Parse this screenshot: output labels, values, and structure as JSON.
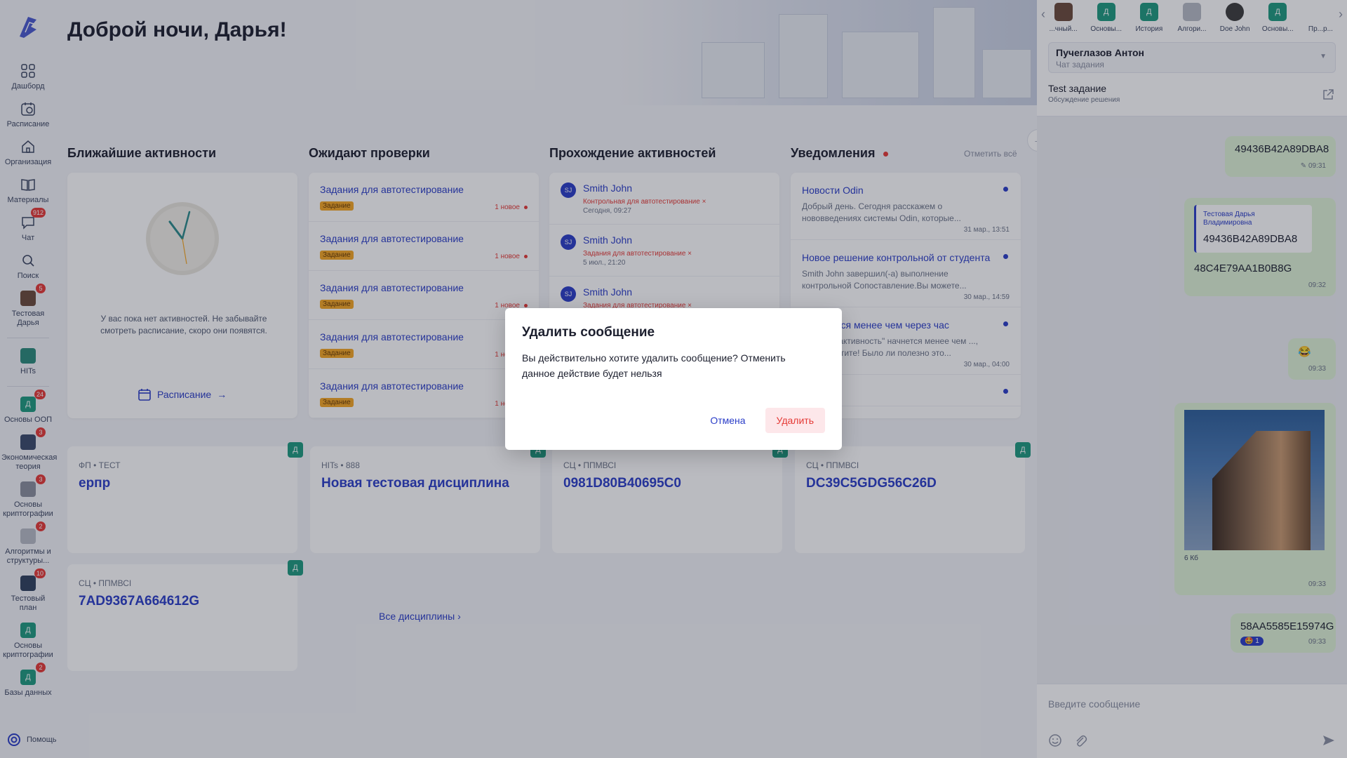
{
  "greeting": "Доброй ночи, Дарья!",
  "sidebar": {
    "items": [
      {
        "label": "Дашборд"
      },
      {
        "label": "Расписание"
      },
      {
        "label": "Организация"
      },
      {
        "label": "Материалы"
      },
      {
        "label": "Чат",
        "badge": "912"
      },
      {
        "label": "Поиск"
      },
      {
        "label": "Тестовая Дарья",
        "badge": "5"
      },
      {
        "label": "HITs"
      },
      {
        "label": "Основы ООП",
        "badge": "24",
        "letter": "Д"
      },
      {
        "label": "Экономическая теория",
        "badge": "3"
      },
      {
        "label": "Основы криптографии",
        "badge": "3"
      },
      {
        "label": "Алгоритмы и структуры...",
        "badge": "2"
      },
      {
        "label": "Тестовый план",
        "badge": "10"
      },
      {
        "label": "Основы криптографии",
        "letter": "Д"
      },
      {
        "label": "Базы данных",
        "badge": "2",
        "letter": "Д"
      }
    ],
    "help": "Помощь"
  },
  "columns": {
    "nearest": {
      "title": "Ближайшие активности",
      "empty": "У вас пока нет активностей. Не забывайте смотреть расписание, скоро они появятся.",
      "link": "Расписание"
    },
    "review": {
      "title": "Ожидают проверки",
      "items": [
        {
          "title": "Задания для автотестирование",
          "tag": "Задание",
          "new": "1 новое"
        },
        {
          "title": "Задания для автотестирование",
          "tag": "Задание",
          "new": "1 новое"
        },
        {
          "title": "Задания для автотестирование",
          "tag": "Задание",
          "new": "1 новое"
        },
        {
          "title": "Задания для автотестирование",
          "tag": "Задание",
          "new": "1 новое"
        },
        {
          "title": "Задания для автотестирование",
          "tag": "Задание",
          "new": "1 новое"
        }
      ]
    },
    "progress": {
      "title": "Прохождение активностей",
      "items": [
        {
          "initials": "SJ",
          "name": "Smith John",
          "sub": "Контрольная для автотестирование ×",
          "date": "Сегодня, 09:27"
        },
        {
          "initials": "SJ",
          "name": "Smith John",
          "sub": "Задания для автотестирование ×",
          "date": "5 июл., 21:20"
        },
        {
          "initials": "SJ",
          "name": "Smith John",
          "sub": "Задания для автотестирование ×",
          "date": ""
        }
      ]
    },
    "notifications": {
      "title": "Уведомления",
      "mark_all": "Отметить всё",
      "items": [
        {
          "title": "Новости Odin",
          "body": "Добрый день. Сегодня расскажем о нововведениях системы Odin, которые...",
          "time": "31 мар., 13:51"
        },
        {
          "title": "Новое решение контрольной от студента",
          "body": "Smith John завершил(-а) выполнение контрольной Сопоставление.Вы можете...",
          "time": "30 мар., 14:59"
        },
        {
          "title": "...начнется менее чем через час",
          "body": "...\"Новая активность\" начнется менее чем ..., не пропустите! Было ли полезно это...",
          "time": "30 мар., 04:00"
        },
        {
          "title": "...Odin",
          "body": "",
          "time": ""
        }
      ]
    }
  },
  "courses": [
    {
      "meta": "ФП • ТЕСТ",
      "name": "ерпр",
      "letter": "Д"
    },
    {
      "meta": "HITs • 888",
      "name": "Новая тестовая дисциплина",
      "letter": "Д"
    },
    {
      "meta": "СЦ • ППМВСI",
      "name": "0981D80B40695C0",
      "letter": "Д"
    },
    {
      "meta": "СЦ • ППМВСI",
      "name": "DC39C5GDG56C26D",
      "letter": "Д"
    },
    {
      "meta": "СЦ • ППМВСI",
      "name": "7AD9367A664612G",
      "letter": "Д"
    }
  ],
  "all_disciplines": "Все дисциплины",
  "chat": {
    "topbar": [
      {
        "label": "...чный...",
        "letter": ""
      },
      {
        "label": "Основы...",
        "letter": "Д"
      },
      {
        "label": "История",
        "letter": "Д"
      },
      {
        "label": "Алгори...",
        "letter": ""
      },
      {
        "label": "Doe John",
        "letter": ""
      },
      {
        "label": "Основы...",
        "letter": "Д"
      },
      {
        "label": "Пр...р...",
        "letter": ""
      }
    ],
    "select": {
      "name": "Пучеглазов Антон",
      "sub": "Чат задания"
    },
    "thread": {
      "title": "Test задание",
      "sub": "Обсуждение решения"
    },
    "messages": [
      {
        "text": "49436B42A89DBA8",
        "time": "09:31"
      },
      {
        "quote_author": "Тестовая Дарья Владимировна",
        "quote_text": "49436B42A89DBA8",
        "text": "48C4E79AA1B0B8G",
        "time": "09:32"
      },
      {
        "text": "😂",
        "time": "09:33"
      },
      {
        "caption": "6 Кб",
        "time": "09:33"
      },
      {
        "text": "58AA5585E15974G",
        "reaction": "🤩 1",
        "time": "09:33"
      }
    ],
    "composer_placeholder": "Введите сообщение"
  },
  "modal": {
    "title": "Удалить сообщение",
    "text": "Вы действительно хотите удалить сообщение? Отменить данное действие будет нельзя",
    "cancel": "Отмена",
    "delete": "Удалить"
  },
  "colors": {
    "accent": "#2a3dc8",
    "green": "#1d9a7e",
    "danger": "#e53935",
    "tag": "#f5a623"
  }
}
